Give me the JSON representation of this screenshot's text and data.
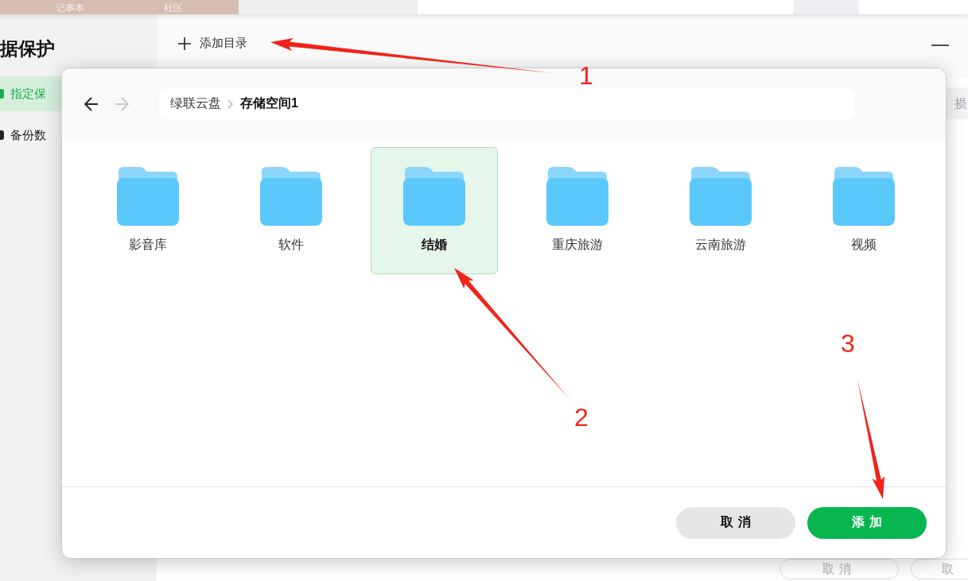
{
  "background": {
    "top_tabs": [
      "记事本",
      "社区"
    ],
    "sidebar": {
      "title": "据保护",
      "items": [
        {
          "label": "指定保",
          "selected": true
        },
        {
          "label": "备份数",
          "selected": false
        }
      ]
    },
    "toolbar": {
      "add_label": "添加目录"
    },
    "side_text": "损",
    "buttons": [
      {
        "label": "取消"
      },
      {
        "label": "取"
      }
    ]
  },
  "dialog": {
    "nav": {
      "back_disabled": false,
      "forward_disabled": true
    },
    "breadcrumb": [
      {
        "label": "绿联云盘",
        "current": false
      },
      {
        "label": "存储空间1",
        "current": true
      }
    ],
    "folders": [
      {
        "name": "影音库",
        "selected": false
      },
      {
        "name": "软件",
        "selected": false
      },
      {
        "name": "结婚",
        "selected": true
      },
      {
        "name": "重庆旅游",
        "selected": false
      },
      {
        "name": "云南旅游",
        "selected": false
      },
      {
        "name": "视频",
        "selected": false
      }
    ],
    "buttons": [
      {
        "label": "取消",
        "kind": "secondary"
      },
      {
        "label": "添加",
        "kind": "primary"
      }
    ]
  },
  "annotations": [
    {
      "label": "1"
    },
    {
      "label": "2"
    },
    {
      "label": "3"
    }
  ]
}
